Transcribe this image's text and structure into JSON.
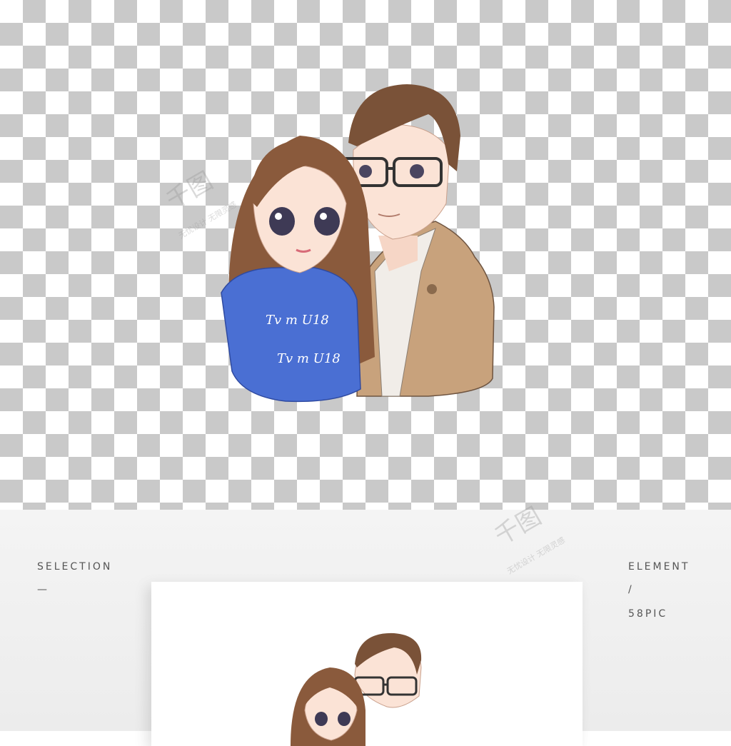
{
  "labels": {
    "selection": "SELECTION",
    "selection_mark": "—",
    "element": "ELEMENT",
    "slash": "/",
    "brand": "58PIC"
  },
  "sweater_text": {
    "line1": "Tv  m  U18",
    "line2": "Tv  m  U18"
  },
  "watermark": {
    "logo": "千图",
    "tagline": "无忧设计 无限灵感"
  },
  "colors": {
    "sweater": "#4a6fd3",
    "coat": "#c8a27c",
    "hair_female": "#8a5a3c",
    "hair_male": "#7a5238",
    "skin": "#fbe3d6"
  }
}
